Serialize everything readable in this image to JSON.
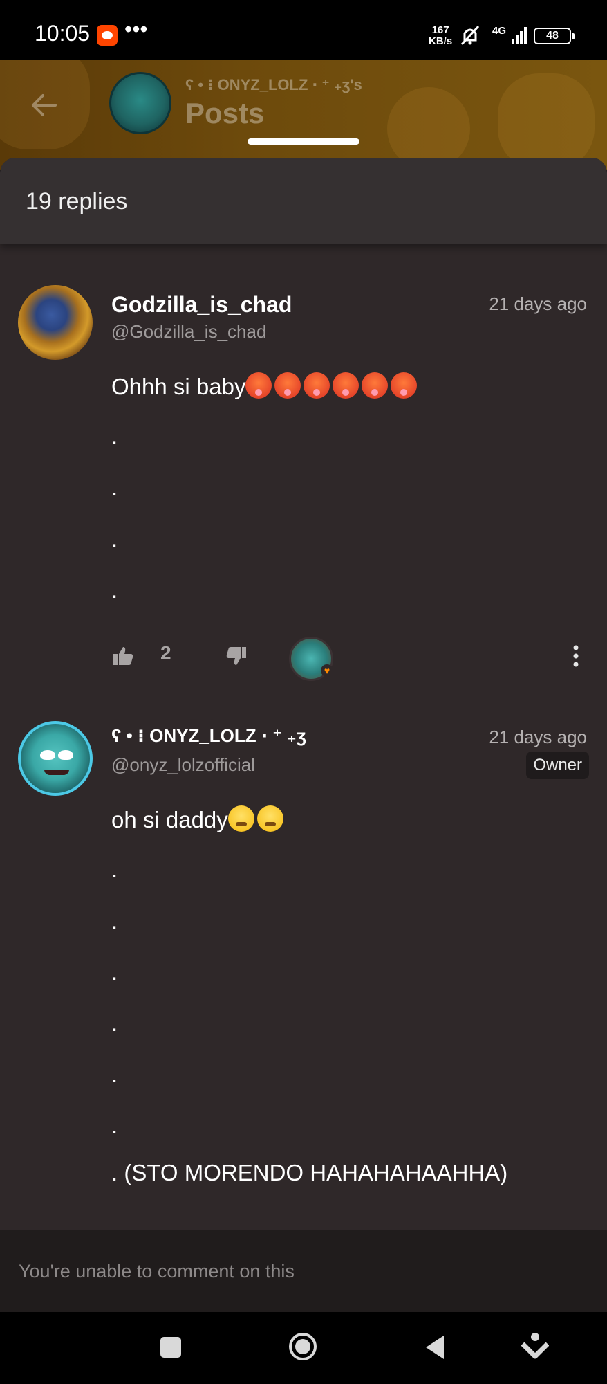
{
  "status_bar": {
    "time": "10:05",
    "overflow": "•••",
    "net_speed_value": "167",
    "net_speed_unit": "KB/s",
    "network": "4G",
    "battery": "48",
    "icons": [
      "reddit-notification-icon",
      "mute-icon",
      "signal-icon",
      "battery-icon"
    ]
  },
  "header": {
    "subtitle": "ʕ • ⁝ ONYZ_LOLZ ‧ ⁺ ₊ʒ's",
    "title": "Posts"
  },
  "sheet": {
    "replies_count": "19 replies"
  },
  "comments": [
    {
      "display_name": "Godzilla_is_chad",
      "handle": "@Godzilla_is_chad",
      "time": "21 days ago",
      "text": "Ohhh si baby",
      "emoji_count": 6,
      "dot_lines": [
        ".",
        ".",
        ".",
        "."
      ],
      "likes": "2"
    },
    {
      "display_name": "ʕ • ⁝ ONYZ_LOLZ ‧ ⁺ ₊ʒ",
      "handle": "@onyz_lolzofficial",
      "time": "21 days ago",
      "badge": "Owner",
      "text": "oh si daddy",
      "emoji_count": 2,
      "dot_lines": [
        ".",
        ".",
        ".",
        ".",
        ".",
        "."
      ],
      "last_line": ". (STO MORENDO HAHAHAHAAHHA)"
    }
  ],
  "footer": {
    "comment_disabled": "You're unable to comment on this"
  },
  "colors": {
    "sheet_bg": "#2f2829",
    "header_bg": "#6d4a0c",
    "owner_badge_bg": "#1f1b1c",
    "avatar_ring": "#4cc9e6"
  }
}
